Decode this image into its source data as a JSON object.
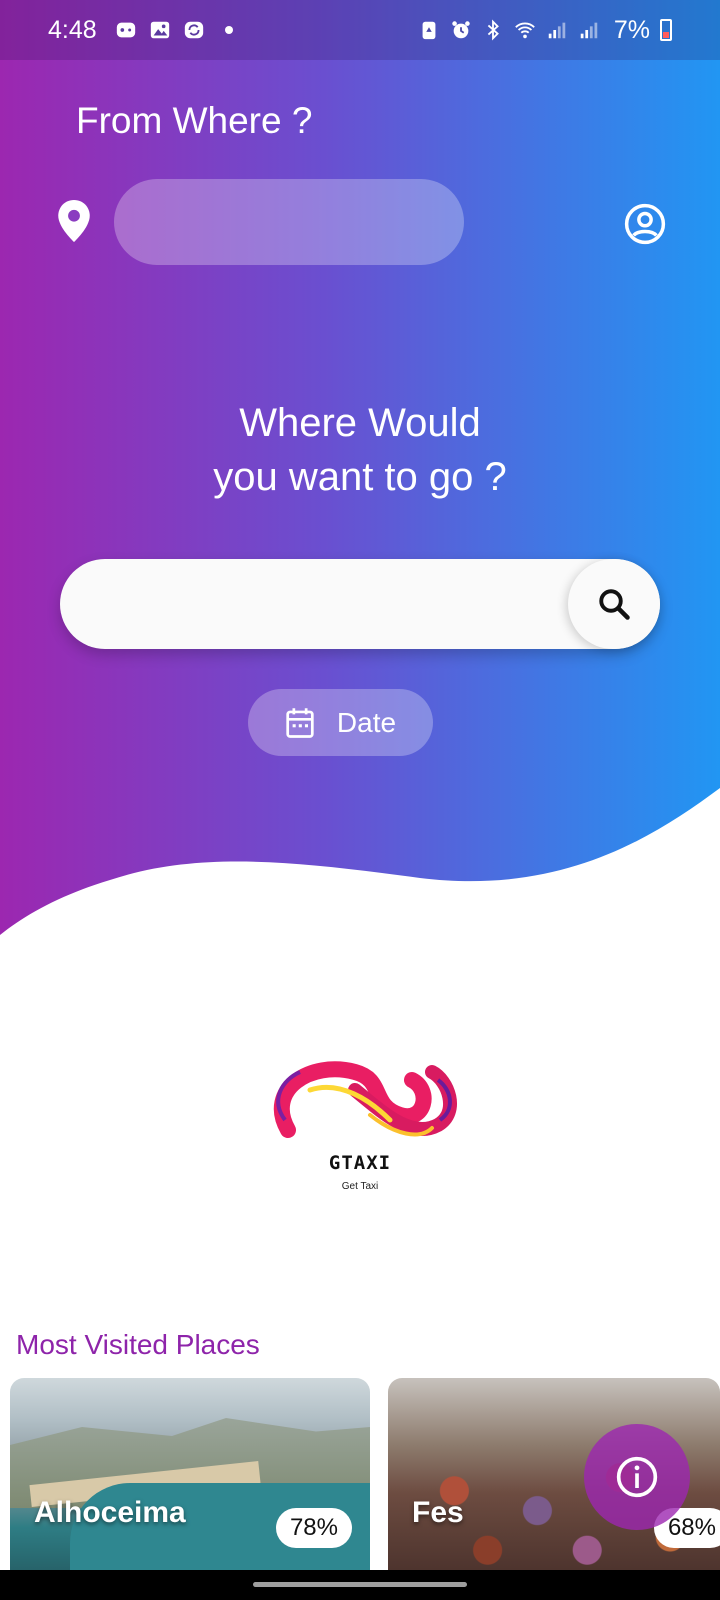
{
  "status_bar": {
    "time": "4:48",
    "battery_percent": "7%"
  },
  "header": {
    "from_title": "From Where ?",
    "from_value": "",
    "from_placeholder": ""
  },
  "destination": {
    "title_line1": "Where Would",
    "title_line2": "you want to go ?",
    "search_value": "",
    "search_placeholder": "",
    "date_label": "Date"
  },
  "brand": {
    "name": "GTAXI",
    "tagline": "Get Taxi"
  },
  "places": {
    "title": "Most Visited Places",
    "items": [
      {
        "name": "Alhoceima",
        "percent": "78%"
      },
      {
        "name": "Fes",
        "percent": "68%"
      }
    ]
  },
  "colors": {
    "gradient_start": "#9C27B0",
    "gradient_end": "#2196F3",
    "section_title": "#8E24AA",
    "fab": "#9C27B0"
  },
  "icons": {
    "location": "location-pin-icon",
    "profile": "account-circle-icon",
    "search": "search-icon",
    "date": "calendar-icon",
    "info": "info-icon"
  }
}
